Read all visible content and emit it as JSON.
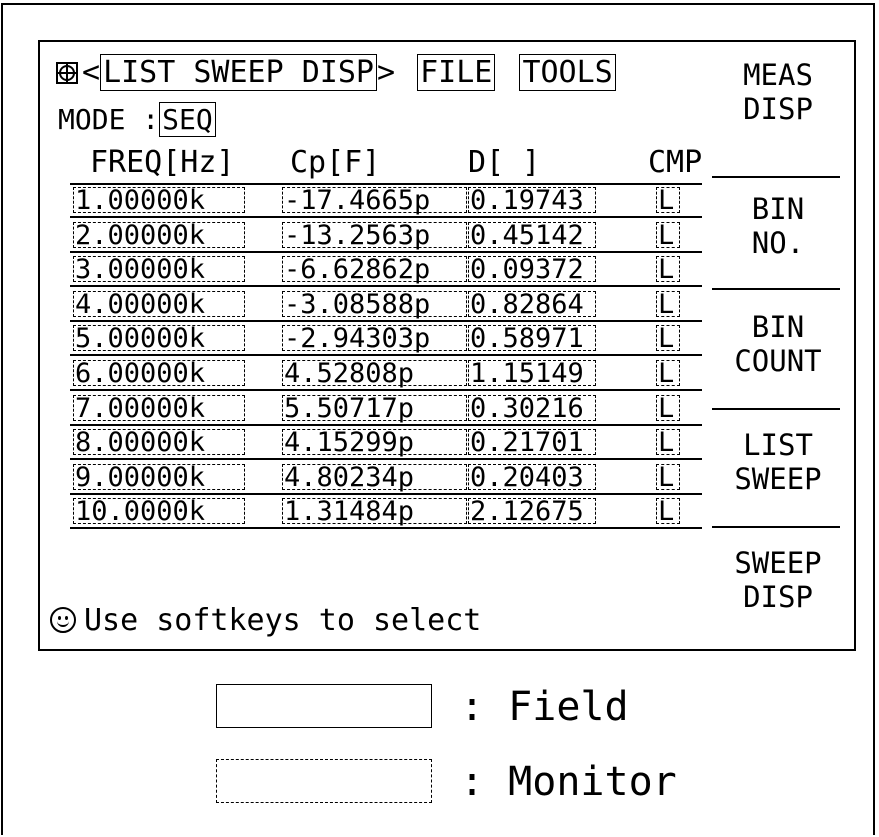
{
  "header": {
    "page_title": "LIST SWEEP DISP",
    "menu_file": "FILE",
    "menu_tools": "TOOLS"
  },
  "mode": {
    "label": "MODE :",
    "value": "SEQ"
  },
  "columns": {
    "freq": "FREQ[Hz]",
    "cp": "Cp[F]",
    "d": "D[ ]",
    "cmp": "CMP"
  },
  "rows": [
    {
      "freq": "1.00000k",
      "cp": "-17.4665p",
      "d": "0.19743",
      "cmp": "L"
    },
    {
      "freq": "2.00000k",
      "cp": "-13.2563p",
      "d": "0.45142",
      "cmp": "L"
    },
    {
      "freq": "3.00000k",
      "cp": "-6.62862p",
      "d": "0.09372",
      "cmp": "L"
    },
    {
      "freq": "4.00000k",
      "cp": "-3.08588p",
      "d": "0.82864",
      "cmp": "L"
    },
    {
      "freq": "5.00000k",
      "cp": "-2.94303p",
      "d": "0.58971",
      "cmp": "L"
    },
    {
      "freq": "6.00000k",
      "cp": "4.52808p",
      "d": "1.15149",
      "cmp": "L"
    },
    {
      "freq": "7.00000k",
      "cp": "5.50717p",
      "d": "0.30216",
      "cmp": "L"
    },
    {
      "freq": "8.00000k",
      "cp": "4.15299p",
      "d": "0.21701",
      "cmp": "L"
    },
    {
      "freq": "9.00000k",
      "cp": "4.80234p",
      "d": "0.20403",
      "cmp": "L"
    },
    {
      "freq": "10.0000k",
      "cp": "1.31484p",
      "d": "2.12675",
      "cmp": "L"
    }
  ],
  "softkeys": [
    {
      "line1": "MEAS",
      "line2": "DISP"
    },
    {
      "line1": "BIN",
      "line2": "NO."
    },
    {
      "line1": "BIN",
      "line2": "COUNT"
    },
    {
      "line1": "LIST",
      "line2": "SWEEP"
    },
    {
      "line1": "SWEEP",
      "line2": "DISP"
    }
  ],
  "status": {
    "icon": "smiley-icon",
    "text": "Use softkeys to select"
  },
  "legend": {
    "field": ": Field",
    "monitor": ": Monitor"
  }
}
